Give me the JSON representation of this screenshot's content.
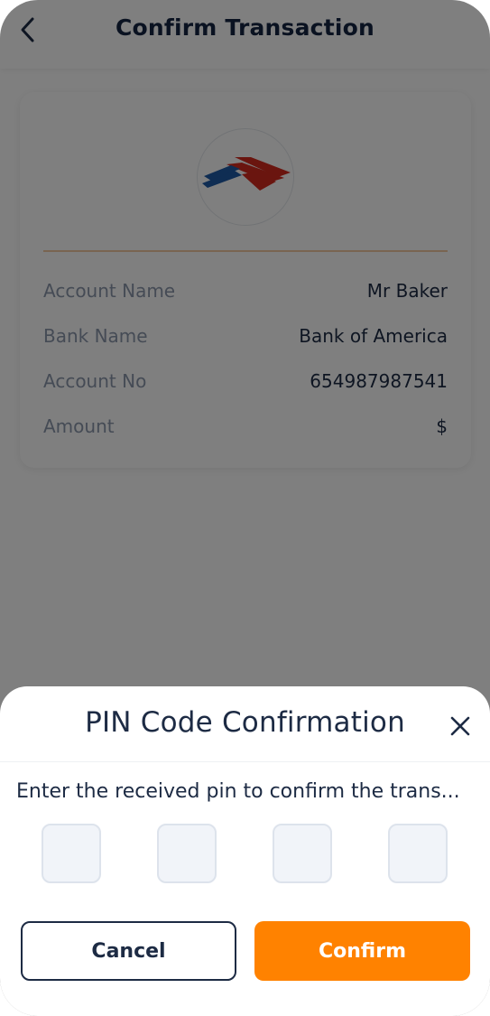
{
  "header": {
    "title": "Confirm Transaction",
    "back_icon": "chevron-left-icon"
  },
  "card": {
    "logo_icon": "bank-of-america-logo",
    "rows": [
      {
        "label": "Account Name",
        "value": "Mr Baker"
      },
      {
        "label": "Bank Name",
        "value": "Bank of America"
      },
      {
        "label": "Account No",
        "value": "654987987541"
      },
      {
        "label": "Amount",
        "value": "$"
      }
    ]
  },
  "sheet": {
    "title": "PIN Code Confirmation",
    "close_icon": "close-icon",
    "instruction": "Enter the received pin to confirm the trans...",
    "pin_values": [
      "",
      "",
      "",
      ""
    ],
    "cancel_label": "Cancel",
    "confirm_label": "Confirm"
  },
  "colors": {
    "accent": "#ff8200",
    "primary_text": "#1d2b44",
    "muted_text": "#8a96ab",
    "logo_red": "#d52b1e",
    "logo_blue": "#1f5aa6"
  }
}
